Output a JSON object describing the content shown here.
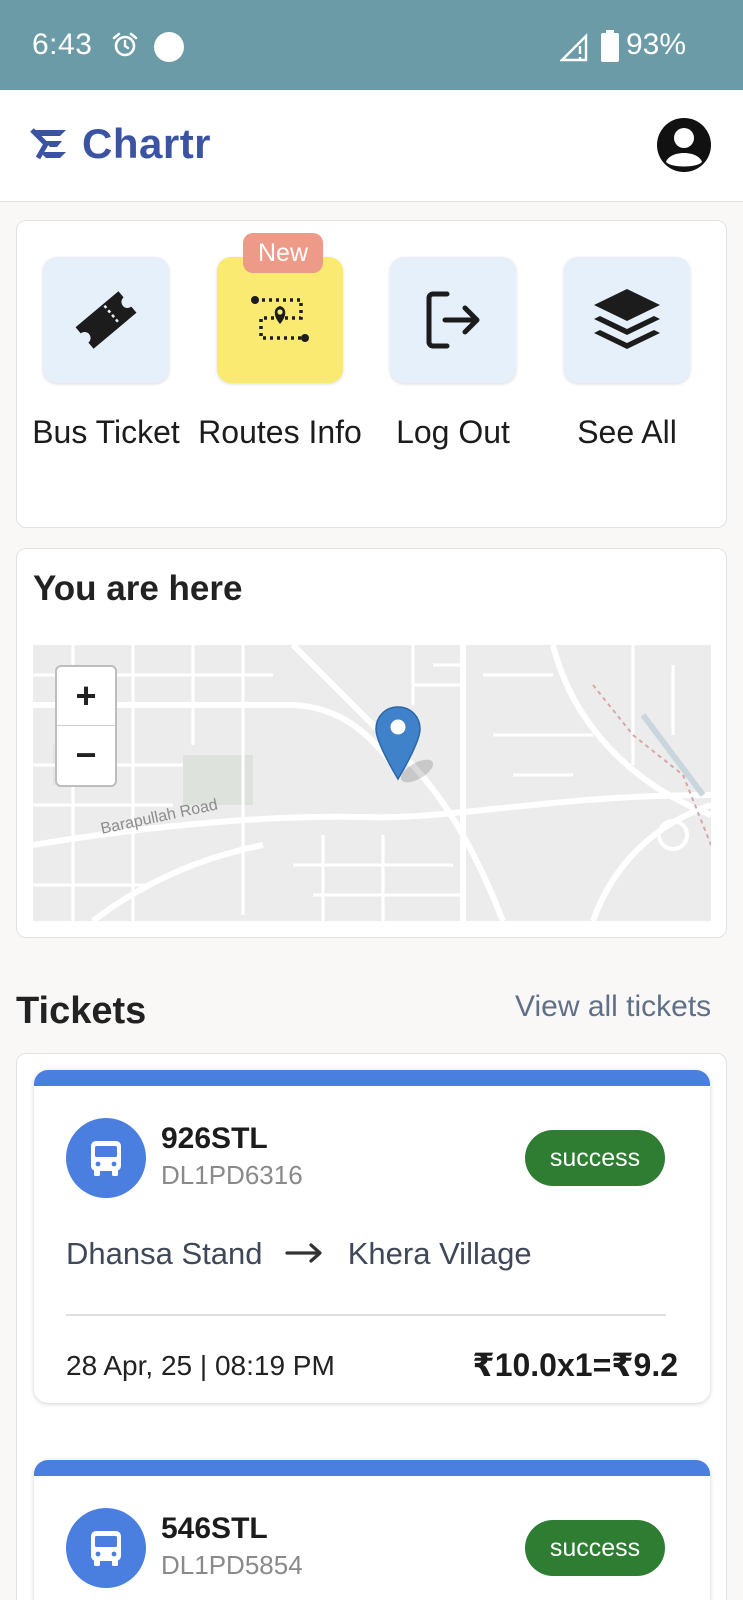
{
  "status_bar": {
    "time": "6:43",
    "battery": "93%"
  },
  "header": {
    "app_name": "Chartr",
    "brand_color": "#3b53a3"
  },
  "quick_actions": [
    {
      "label": "Bus Ticket",
      "icon": "ticket-icon"
    },
    {
      "label": "Routes Info",
      "icon": "route-map-icon",
      "badge": "New"
    },
    {
      "label": "Log Out",
      "icon": "logout-icon"
    },
    {
      "label": "See All",
      "icon": "layers-icon"
    }
  ],
  "map": {
    "title": "You are here",
    "zoom_in": "+",
    "zoom_out": "−",
    "road_label": "Barapullah Road"
  },
  "tickets": {
    "title": "Tickets",
    "view_all": "View all tickets",
    "accent_color": "#4a7fe0",
    "success_color": "#2e7d32",
    "items": [
      {
        "route": "926STL",
        "vehicle": "DL1PD6316",
        "status": "success",
        "from": "Dhansa Stand",
        "to": "Khera Village",
        "datetime": "28 Apr, 25 | 08:19 PM",
        "fare": "₹10.0x1=₹9.2"
      },
      {
        "route": "546STL",
        "vehicle": "DL1PD5854",
        "status": "success"
      }
    ]
  }
}
